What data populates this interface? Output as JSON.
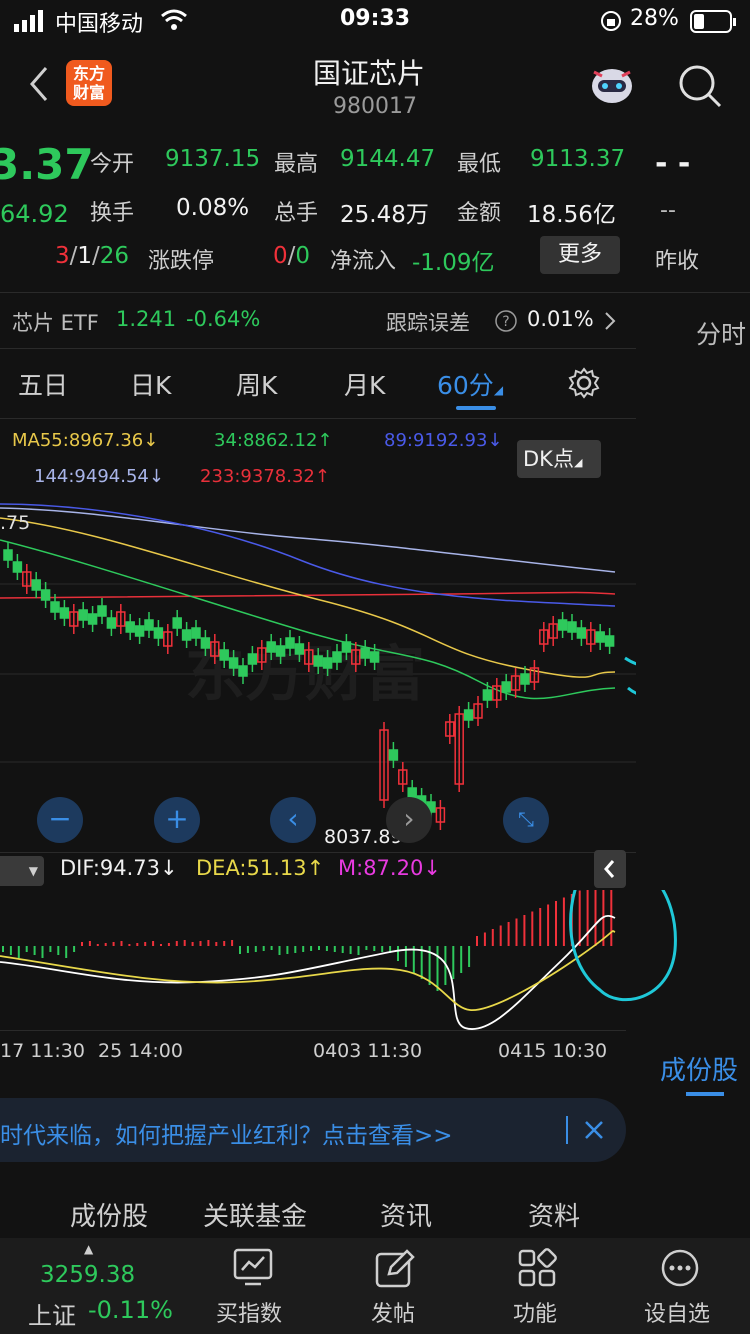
{
  "status_bar": {
    "carrier": "中国移动",
    "time": "09:33",
    "battery": "28%"
  },
  "header": {
    "title": "国证芯片",
    "code": "980017",
    "logo_line1": "东方",
    "logo_line2": "财富"
  },
  "quote": {
    "price_partial": "3.37",
    "change_partial": "64.92",
    "open_label": "今开",
    "open": "9137.15",
    "high_label": "最高",
    "high": "9144.47",
    "low_label": "最低",
    "low": "9113.37",
    "turnover_label": "换手",
    "turnover": "0.08%",
    "volume_label": "总手",
    "volume": "25.48万",
    "amount_label": "金额",
    "amount": "18.56亿",
    "updown_a": "3",
    "updown_b": "1",
    "updown_c": "26",
    "sep": "/",
    "limit_label": "涨跌停",
    "limit_a": "0",
    "limit_b": "0",
    "netflow_label": "净流入",
    "netflow": "-1.09亿",
    "more_label": "更多",
    "dash1": "- -",
    "dash2": "--",
    "prev_close_label": "昨收"
  },
  "etf": {
    "label": "芯片 ETF",
    "price": "1.241",
    "change": "-0.64%",
    "tracking_label": "跟踪误差",
    "tracking": "0.01%"
  },
  "side_tab": "分时",
  "period_tabs": [
    "五日",
    "日K",
    "周K",
    "月K",
    "60分"
  ],
  "ma": {
    "ma55": "MA55:8967.36",
    "ma34": "34:8862.12",
    "ma89": "89:9192.93",
    "ma144": "144:9494.54",
    "ma233": "233:9378.32",
    "down_arrow": "↓",
    "up_arrow": "↑"
  },
  "dk_button": "DK点",
  "chart_labels": {
    "top_partial": ".75",
    "low_price": "8037.89"
  },
  "macd": {
    "dif": "DIF:94.73",
    "dea": "DEA:51.13",
    "m": "M:87.20"
  },
  "time_axis": [
    "17 11:30",
    "25 14:00",
    "0403 11:30",
    "0415 10:30"
  ],
  "components_side": "成份股",
  "banner": {
    "text": "时代来临，如何把握产业红利？点击查看>>"
  },
  "bottom_tabs": [
    "成份股",
    "关联基金",
    "资讯",
    "资料"
  ],
  "nav": {
    "index_value": "3259.38",
    "index_name": "上证",
    "index_change": "-0.11%",
    "items": [
      "买指数",
      "发帖",
      "功能",
      "设自选"
    ]
  },
  "colors": {
    "up": "#f0313a",
    "down": "#2ec95c",
    "accent": "#3a8ee6",
    "cyan": "#1fc8d8"
  }
}
